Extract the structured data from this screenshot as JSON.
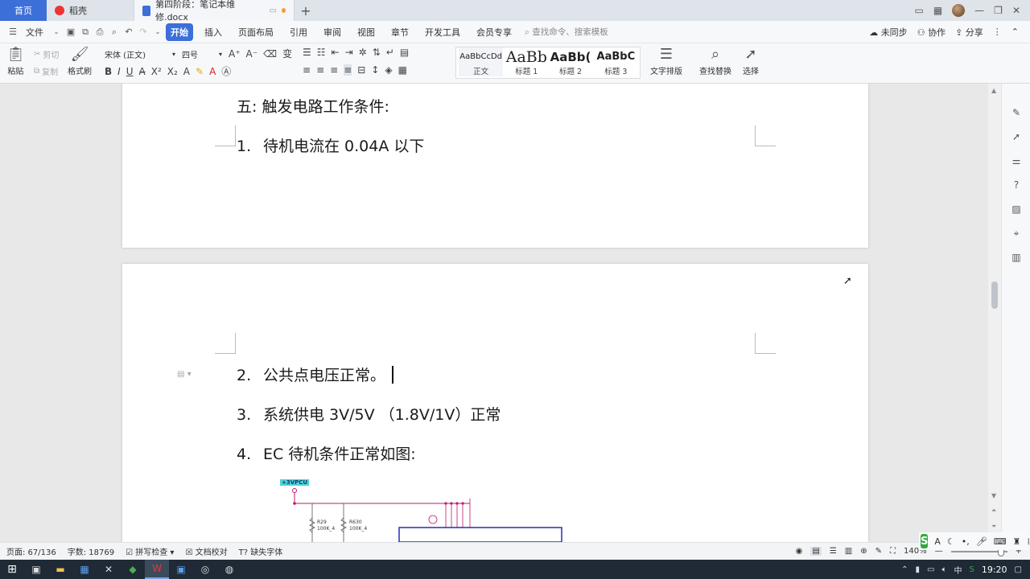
{
  "tabs": {
    "home": "首页",
    "daoke": "稻壳",
    "document": "第四阶段：笔记本维修.docx"
  },
  "menu": {
    "file": "文件",
    "items": [
      "开始",
      "插入",
      "页面布局",
      "引用",
      "审阅",
      "视图",
      "章节",
      "开发工具",
      "会员专享"
    ],
    "search_placeholder": "查找命令、搜索模板",
    "sync": "未同步",
    "collab": "协作",
    "share": "分享"
  },
  "ribbon": {
    "paste": "粘贴",
    "cut": "剪切",
    "copy": "复制",
    "format_painter": "格式刷",
    "font_name": "宋体 (正文)",
    "font_size": "四号",
    "styles": [
      {
        "sample": "AaBbCcDd",
        "label": "正文"
      },
      {
        "sample": "AaBb",
        "label": "标题 1"
      },
      {
        "sample": "AaBb(",
        "label": "标题 2"
      },
      {
        "sample": "AaBbC",
        "label": "标题 3"
      }
    ],
    "text_layout": "文字排版",
    "find_replace": "查找替换",
    "select": "选择"
  },
  "document": {
    "page1": {
      "heading": "五:  触发电路工作条件:",
      "item1_num": "1.",
      "item1_text": "待机电流在 0.04A 以下"
    },
    "page2": {
      "item2_num": "2.",
      "item2_text": "公共点电压正常。",
      "item3_num": "3.",
      "item3_text": "系统供电 3V/5V  （1.8V/1V）正常",
      "item4_num": "4.",
      "item4_text": "EC 待机条件正常如图:"
    },
    "schematic": {
      "net_label": "+3VPCU",
      "r29": "R29",
      "r29_val": "100K_4",
      "r630": "R630",
      "r630_val": "100K_4"
    }
  },
  "status": {
    "page": "页面: 67/136",
    "words": "字数: 18769",
    "spell": "拼写检查",
    "proof": "文档校对",
    "missing_font": "缺失字体",
    "zoom": "140%"
  },
  "taskbar": {
    "time": "19:20"
  }
}
